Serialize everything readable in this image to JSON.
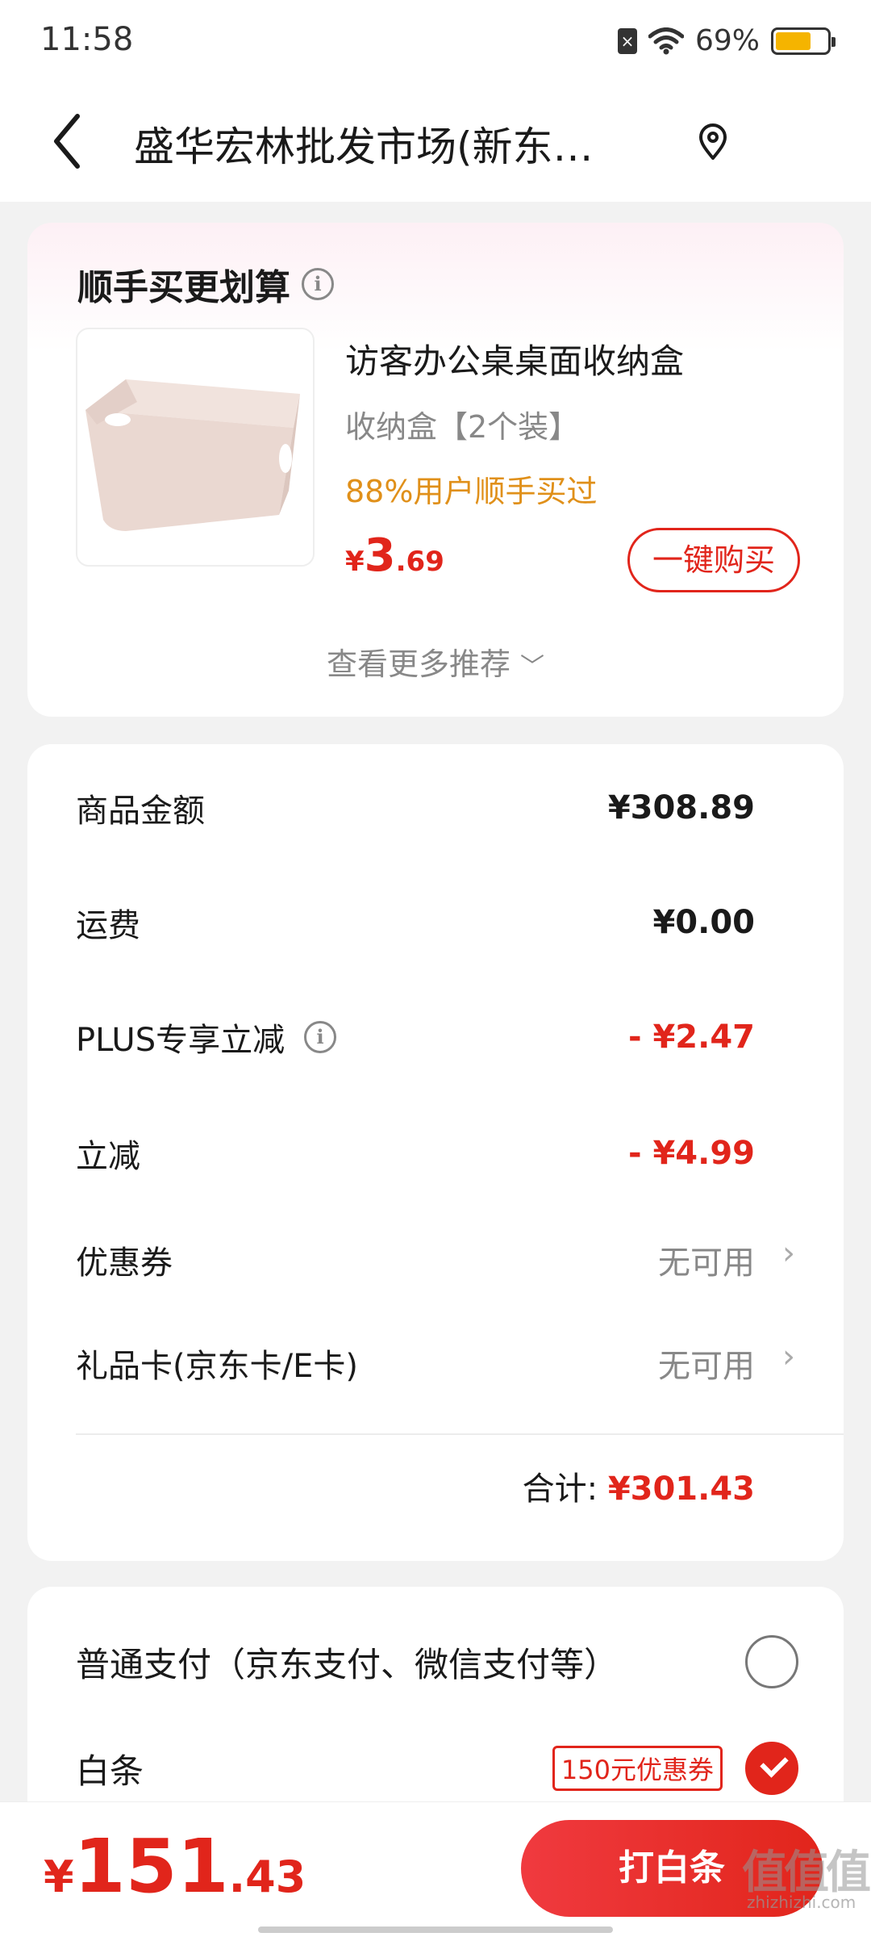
{
  "status_bar": {
    "time": "11:58",
    "battery_percent": "69%",
    "battery_level": 0.69,
    "battery_color": "#f5b400"
  },
  "nav": {
    "title": "盛华宏林批发市场(新东…",
    "back_icon": "chevron-left-icon",
    "location_icon": "location-pin-icon"
  },
  "recommend": {
    "title": "顺手买更划算",
    "product": {
      "name": "访客办公桌桌面收纳盒",
      "spec": "收纳盒【2个装】",
      "popularity": "88%用户顺手买过",
      "price_currency": "¥",
      "price_int": "3",
      "price_dec": ".69",
      "buy_label": "一键购买"
    },
    "more_label": "查看更多推荐"
  },
  "summary": {
    "rows": [
      {
        "label": "商品金额",
        "value": "¥308.89"
      },
      {
        "label": "运费",
        "value": "¥0.00"
      },
      {
        "label": "PLUS专享立减",
        "value": "- ¥2.47"
      },
      {
        "label": "立减",
        "value": "- ¥4.99"
      },
      {
        "label": "优惠券",
        "value": "无可用"
      },
      {
        "label": "礼品卡(京东卡/E卡)",
        "value": "无可用"
      }
    ],
    "total_label": "合计:",
    "total_value": "¥301.43"
  },
  "payment": {
    "options": [
      {
        "label": "普通支付（京东支付、微信支付等）",
        "selected": false
      },
      {
        "label": "白条",
        "coupon": "150元优惠券",
        "selected": true
      }
    ]
  },
  "bottom": {
    "currency": "¥",
    "price_int": "151",
    "price_dec": ".43",
    "pay_label": "打白条"
  },
  "watermark": {
    "text": "值值值",
    "sub": "zhizhizhi.com"
  },
  "colors": {
    "accent_red": "#e1251b",
    "popularity_orange": "#e0901a"
  }
}
